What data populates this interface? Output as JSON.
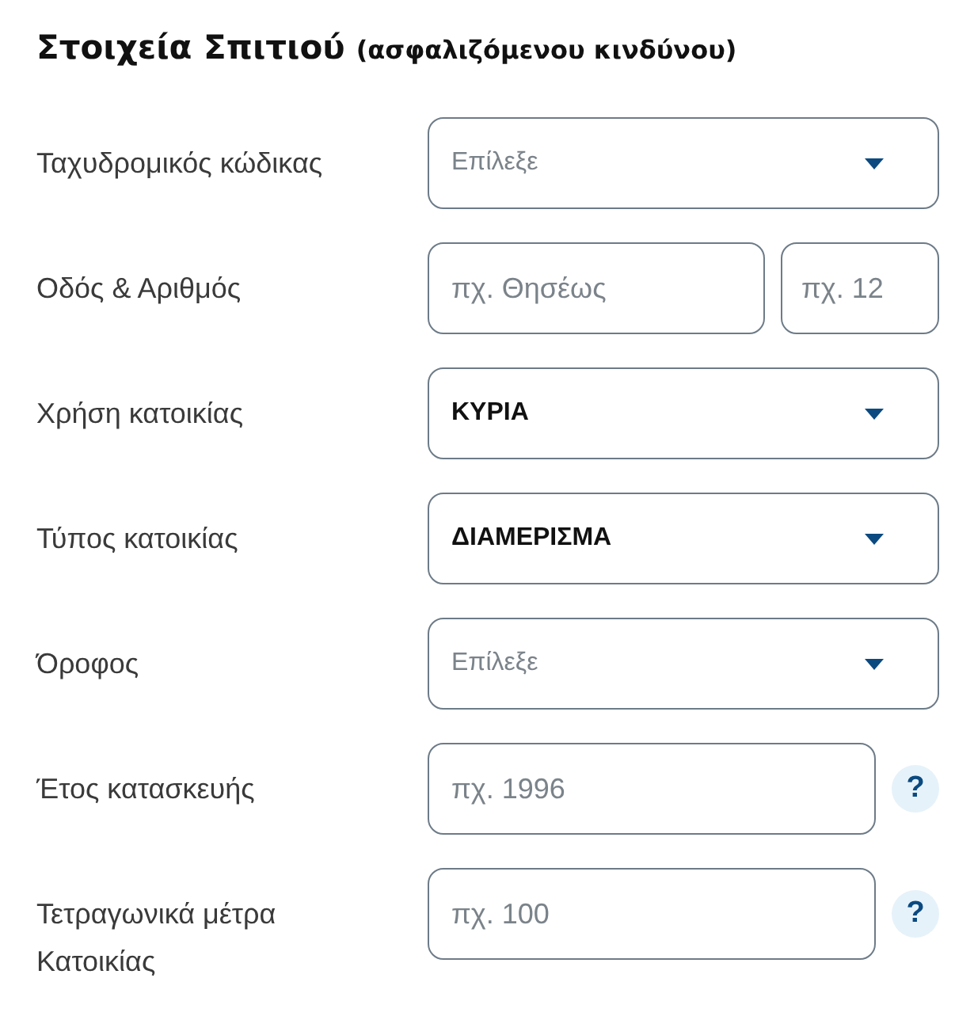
{
  "heading": {
    "title": "Στοιχεία Σπιτιού",
    "subtitle": "(ασφαλιζόμενου κινδύνου)"
  },
  "fields": [
    {
      "kind": "select",
      "label": "Ταχυδρομικός κώδικας",
      "placeholder": "Επίλεξε"
    },
    {
      "kind": "pair",
      "label": "Οδός & Αριθμός",
      "placeholder": "πχ. Θησέως",
      "placeholder_2": "πχ. 12"
    },
    {
      "kind": "select",
      "label": "Χρήση κατοικίας",
      "value": "ΚΥΡΙΑ"
    },
    {
      "kind": "select",
      "label": "Τύπος κατοικίας",
      "value": "ΔΙΑΜΕΡΙΣΜΑ"
    },
    {
      "kind": "select",
      "label": "Όροφος",
      "placeholder": "Επίλεξε"
    },
    {
      "kind": "help",
      "label": "Έτος κατασκευής",
      "placeholder": "πχ. 1996",
      "help": "?"
    },
    {
      "kind": "help",
      "label": "Τετραγωνικά μέτρα Κατοικίας",
      "placeholder": "πχ. 100",
      "help": "?"
    }
  ]
}
